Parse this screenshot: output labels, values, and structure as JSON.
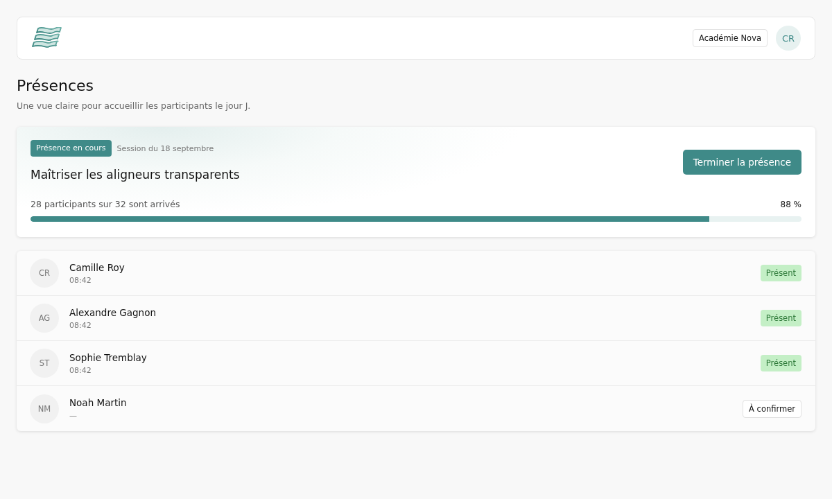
{
  "header": {
    "organization": "Académie Nova",
    "user_initials": "CR"
  },
  "page": {
    "title": "Présences",
    "subtitle": "Une vue claire pour accueillir les participants le jour J."
  },
  "session": {
    "status_badge": "Présence en cours",
    "date": "Session du 18 septembre",
    "title": "Maîtriser les aligneurs transparents",
    "end_button": "Terminer la présence",
    "progress_text": "28 participants sur 32 sont arrivés",
    "progress_percent": "88 %",
    "level": 0.88
  },
  "participants": [
    {
      "initials": "CR",
      "name": "Camille Roy",
      "time": "08:42",
      "status": "Présent",
      "kind": "present"
    },
    {
      "initials": "AG",
      "name": "Alexandre Gagnon",
      "time": "08:42",
      "status": "Présent",
      "kind": "present"
    },
    {
      "initials": "ST",
      "name": "Sophie Tremblay",
      "time": "08:42",
      "status": "Présent",
      "kind": "present"
    },
    {
      "initials": "NM",
      "name": "Noah Martin",
      "time": "—",
      "status": "À confirmer",
      "kind": "pending"
    }
  ]
}
